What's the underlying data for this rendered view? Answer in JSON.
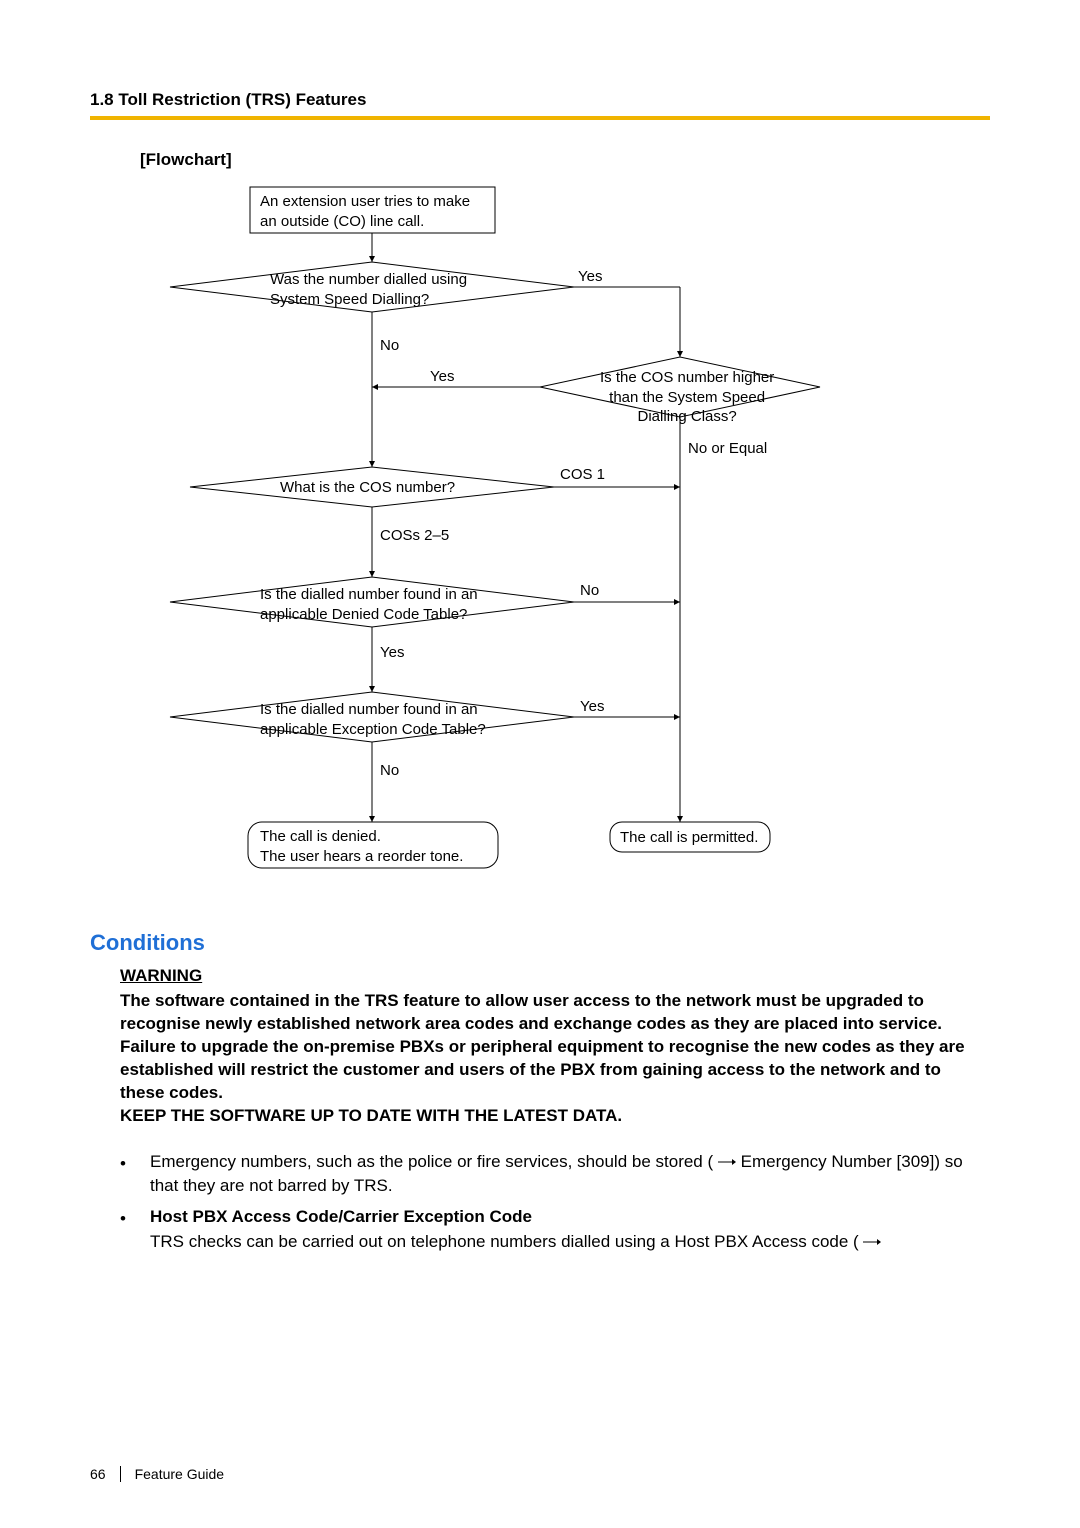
{
  "header": {
    "section": "1.8 Toll Restriction (TRS) Features"
  },
  "flowchart": {
    "title": "[Flowchart]",
    "start": "An extension user tries to make\nan outside (CO) line call.",
    "d1": "Was the number dialled using\nSystem Speed Dialling?",
    "d1_yes": "Yes",
    "d1_no": "No",
    "d2": "Is the COS number higher\nthan the System Speed\nDialling Class?",
    "d2_yes": "Yes",
    "d2_no": "No or Equal",
    "d3": "What is the COS number?",
    "d3_cos1": "COS 1",
    "d3_cos25": "COSs 2–5",
    "d4": "Is the dialled number found in an\napplicable Denied Code Table?",
    "d4_yes": "Yes",
    "d4_no": "No",
    "d5": "Is the dialled number found in an\napplicable Exception Code Table?",
    "d5_yes": "Yes",
    "d5_no": "No",
    "term_denied": "The call is denied.\nThe user hears a reorder tone.",
    "term_permitted": "The call is permitted."
  },
  "conditions": {
    "title": "Conditions",
    "warning_label": "WARNING",
    "warning_p1": "The software contained in the TRS feature to allow user access to the network must be upgraded to recognise newly established network area codes and exchange codes as they are placed into service.",
    "warning_p2": "Failure to upgrade the on-premise PBXs or peripheral equipment to recognise the new codes as they are established will restrict the customer and users of the PBX from gaining access to the network and to these codes.",
    "warning_p3": "KEEP THE SOFTWARE UP TO DATE WITH THE LATEST DATA.",
    "items": [
      {
        "pre": "Emergency numbers, such as the police or fire services, should be stored (",
        "post": " Emergency Number [309]) so that they are not barred by TRS."
      },
      {
        "title": "Host PBX Access Code/Carrier Exception Code",
        "pre": "TRS checks can be carried out on telephone numbers dialled using a Host PBX Access code (",
        "post": ""
      }
    ]
  },
  "footer": {
    "page": "66",
    "doc": "Feature Guide"
  }
}
